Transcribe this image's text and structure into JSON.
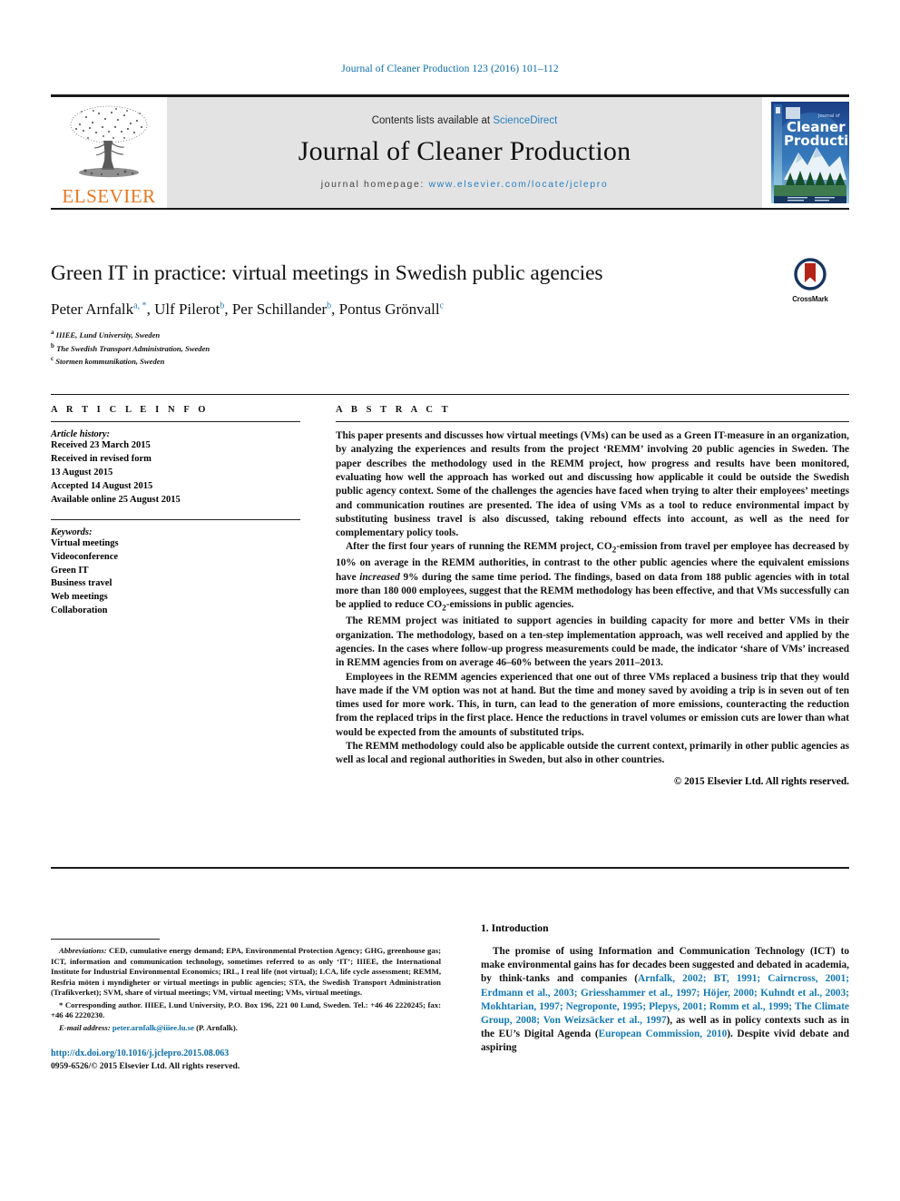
{
  "running_head": "Journal of Cleaner Production 123 (2016) 101–112",
  "masthead": {
    "publisher": "ELSEVIER",
    "contents_prefix": "Contents lists available at ",
    "contents_link": "ScienceDirect",
    "journal_name": "Journal of Cleaner Production",
    "homepage_prefix": "journal homepage: ",
    "homepage_url": "www.elsevier.com/locate/jclepro",
    "cover": {
      "line1": "Journal of",
      "line2": "Cleaner",
      "line3": "Production"
    }
  },
  "title": "Green IT in practice: virtual meetings in Swedish public agencies",
  "authors": [
    {
      "name": "Peter Arnfalk",
      "marks": "a, *"
    },
    {
      "name": "Ulf Pilerot",
      "marks": "b"
    },
    {
      "name": "Per Schillander",
      "marks": "b"
    },
    {
      "name": "Pontus Grönvall",
      "marks": "c"
    }
  ],
  "affiliations": [
    {
      "mark": "a",
      "text": "IIIEE, Lund University, Sweden"
    },
    {
      "mark": "b",
      "text": "The Swedish Transport Administration, Sweden"
    },
    {
      "mark": "c",
      "text": "Stormen kommunikation, Sweden"
    }
  ],
  "crossmark_label": "CrossMark",
  "article_info": {
    "heading": "A R T I C L E  I N F O",
    "history_label": "Article history:",
    "history": [
      "Received 23 March 2015",
      "Received in revised form",
      "13 August 2015",
      "Accepted 14 August 2015",
      "Available online 25 August 2015"
    ],
    "keywords_label": "Keywords:",
    "keywords": [
      "Virtual meetings",
      "Videoconference",
      "Green IT",
      "Business travel",
      "Web meetings",
      "Collaboration"
    ]
  },
  "abstract": {
    "heading": "A B S T R A C T",
    "paragraphs": [
      "This paper presents and discusses how virtual meetings (VMs) can be used as a Green IT-measure in an organization, by analyzing the experiences and results from the project ‘REMM’ involving 20 public agencies in Sweden. The paper describes the methodology used in the REMM project, how progress and results have been monitored, evaluating how well the approach has worked out and discussing how applicable it could be outside the Swedish public agency context. Some of the challenges the agencies have faced when trying to alter their employees’ meetings and communication routines are presented. The idea of using VMs as a tool to reduce environmental impact by substituting business travel is also discussed, taking rebound effects into account, as well as the need for complementary policy tools.",
      "The REMM project was initiated to support agencies in building capacity for more and better VMs in their organization. The methodology, based on a ten-step implementation approach, was well received and applied by the agencies. In the cases where follow-up progress measurements could be made, the indicator ‘share of VMs’ increased in REMM agencies from on average 46–60% between the years 2011–2013.",
      "Employees in the REMM agencies experienced that one out of three VMs replaced a business trip that they would have made if the VM option was not at hand. But the time and money saved by avoiding a trip is in seven out of ten times used for more work. This, in turn, can lead to the generation of more emissions, counteracting the reduction from the replaced trips in the first place. Hence the reductions in travel volumes or emission cuts are lower than what would be expected from the amounts of substituted trips.",
      "The REMM methodology could also be applicable outside the current context, primarily in other public agencies as well as local and regional authorities in Sweden, but also in other countries."
    ],
    "para2_parts": {
      "a": "After the first four years of running the REMM project, CO",
      "sub1": "2",
      "b": "-emission from travel per employee has decreased by 10% on average in the REMM authorities, in contrast to the other public agencies where the equivalent emissions have ",
      "ital": "increased",
      "c": " 9% during the same time period. The findings, based on data from 188 public agencies with in total more than 180 000 employees, suggest that the REMM methodology has been effective, and that VMs successfully can be applied to reduce CO",
      "sub2": "2",
      "d": "-emissions in public agencies."
    },
    "copyright": "© 2015 Elsevier Ltd. All rights reserved."
  },
  "footnotes": {
    "abbrev_label": "Abbreviations:",
    "abbrev_text": " CED, cumulative energy demand; EPA, Environmental Protection Agency; GHG, greenhouse gas; ICT, information and communication technology, sometimes referred to as only ‘IT’; IIIEE, the International Institute for Industrial Environmental Economics; IRL, I real life (not virtual); LCA, life cycle assessment; REMM, Resfria möten i myndigheter or virtual meetings in public agencies; STA, the Swedish Transport Administration (Trafikverket); SVM, share of virtual meetings; VM, virtual meeting; VMs, virtual meetings.",
    "corresponding": "* Corresponding author. IIIEE, Lund University, P.O. Box 196, 221 00 Lund, Sweden. Tel.: +46 46 2220245; fax: +46 46 2220230.",
    "email_label": "E-mail address:",
    "email": "peter.arnfalk@iiiee.lu.se",
    "email_suffix": " (P. Arnfalk).",
    "doi": "http://dx.doi.org/10.1016/j.jclepro.2015.08.063",
    "issn": "0959-6526/© 2015 Elsevier Ltd. All rights reserved."
  },
  "introduction": {
    "heading": "1.  Introduction",
    "parts": {
      "p1a": "The promise of using Information and Communication Technology (ICT) to make environmental gains has for decades been suggested and debated in academia, by think-tanks and companies (",
      "cite1": "Arnfalk, 2002; BT, 1991; Cairncross, 2001; Erdmann et al., 2003; Griesshammer et al., 1997; Höjer, 2000; Kuhndt et al., 2003; Mokhtarian, 1997; Negroponte, 1995; Plepys, 2001; Romm et al., 1999; The Climate Group, 2008; Von Weizsäcker et al., 1997",
      "p1b": "), as well as in policy contexts such as in the EU’s Digital Agenda (",
      "cite2": "European Commission, 2010",
      "p1c": "). Despite vivid debate and aspiring"
    }
  },
  "colors": {
    "link_blue": "#0b6ca8",
    "cite_blue": "#1278b4",
    "elsevier_orange": "#E87722",
    "masthead_grey": "#e3e3e3"
  }
}
